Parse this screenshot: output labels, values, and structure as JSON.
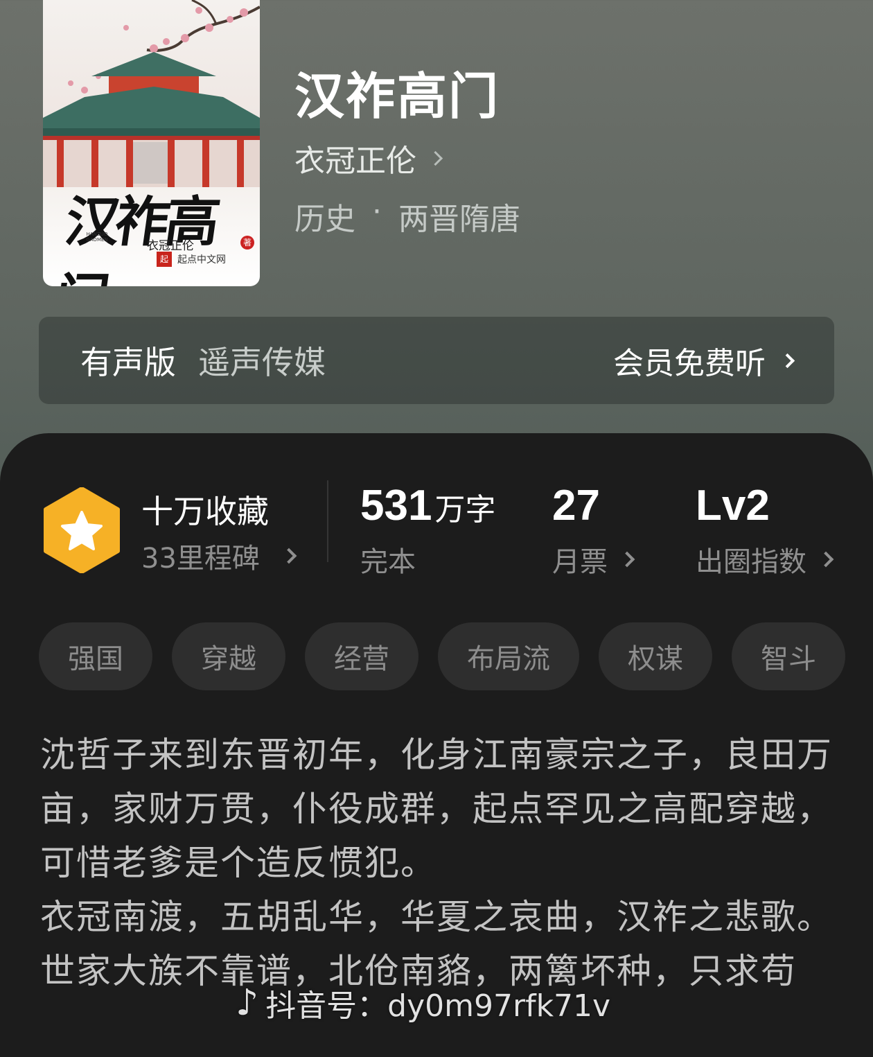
{
  "book": {
    "title": "汉祚高门",
    "author": "衣冠正伦",
    "genre": "历史",
    "subgenre": "两晋隋唐",
    "genre_separator": "·"
  },
  "cover": {
    "title": "汉祚高门",
    "author": "衣冠正伦",
    "author_mark": "著",
    "pinyin": "HANZUO GAOMEN",
    "publisher_icon": "起",
    "publisher": "起点中文网"
  },
  "audio": {
    "label": "有声版",
    "publisher": "遥声传媒",
    "cta": "会员免费听"
  },
  "stats": {
    "favorites": "十万收藏",
    "milestones": "33里程碑",
    "word_count": "531",
    "word_unit": "万字",
    "status": "完本",
    "monthly_tickets": "27",
    "monthly_label": "月票",
    "level": "Lv2",
    "level_label": "出圈指数"
  },
  "tags": [
    "强国",
    "穿越",
    "经营",
    "布局流",
    "权谋",
    "智斗"
  ],
  "description": [
    "沈哲子来到东晋初年，化身江南豪宗之子，良田万亩，家财万贯，仆役成群，起点罕见之高配穿越，可惜老爹是个造反惯犯。",
    "衣冠南渡，五胡乱华，华夏之哀曲，汉祚之悲歌。",
    "世家大族不靠谱，北伧南貉，两篱坏种，只求苟"
  ],
  "watermark": {
    "icon": "tiktok-icon",
    "text": "抖音号：dy0m97rfk71v"
  },
  "colors": {
    "badge": "#f6b126",
    "panel": "#1c1c1c",
    "tag_bg": "#2e2e2e"
  }
}
